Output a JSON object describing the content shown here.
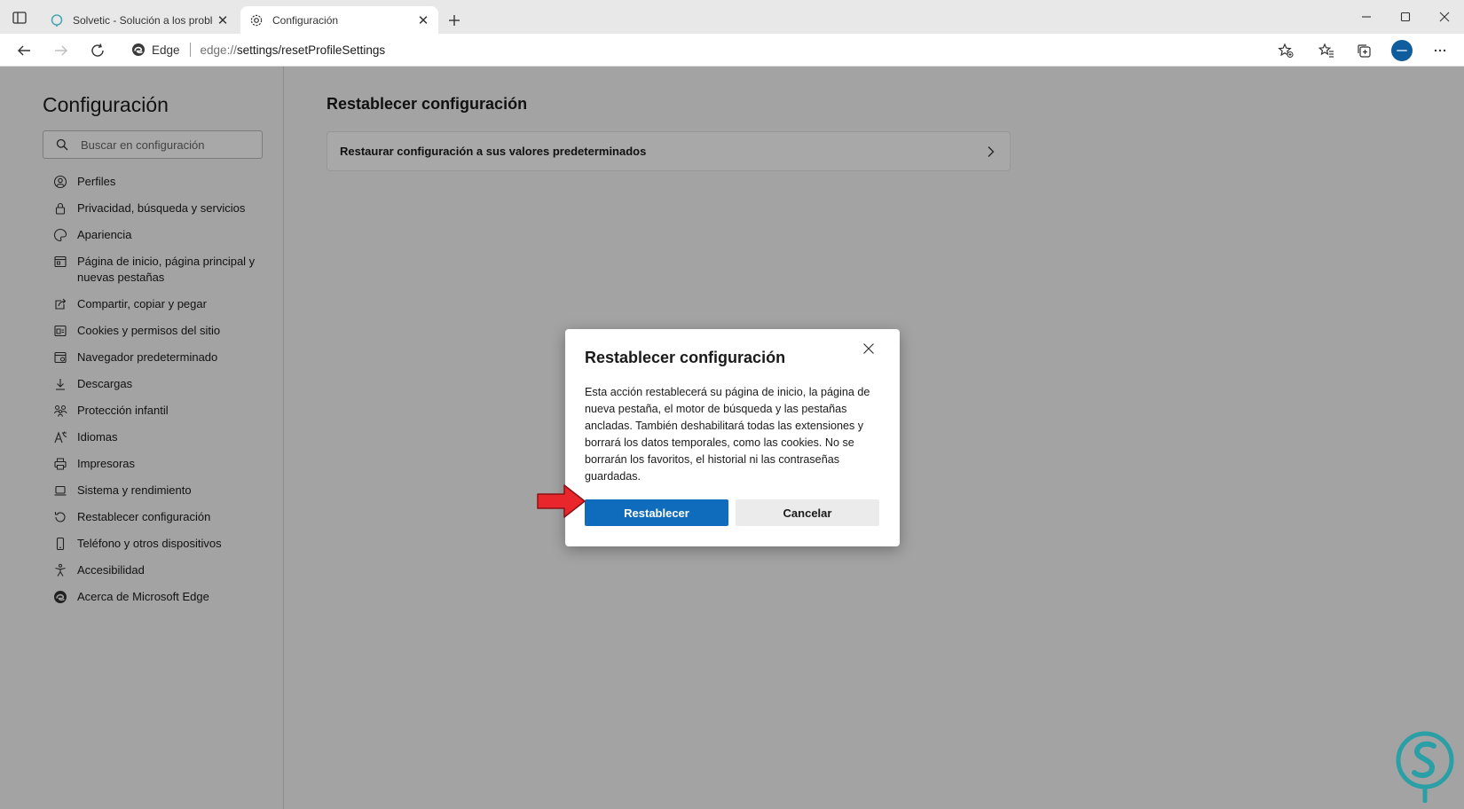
{
  "browser": {
    "tabs": [
      {
        "title": "Solvetic - Solución a los problem",
        "active": false
      },
      {
        "title": "Configuración",
        "active": true
      }
    ],
    "address": {
      "badge": "Edge",
      "scheme": "edge://",
      "path": "settings/resetProfileSettings"
    }
  },
  "settings": {
    "title": "Configuración",
    "search_placeholder": "Buscar en configuración",
    "nav": [
      {
        "label": "Perfiles",
        "icon": "profile-icon"
      },
      {
        "label": "Privacidad, búsqueda y servicios",
        "icon": "lock-icon"
      },
      {
        "label": "Apariencia",
        "icon": "palette-icon"
      },
      {
        "label": "Página de inicio, página principal y nuevas pestañas",
        "icon": "home-page-icon"
      },
      {
        "label": "Compartir, copiar y pegar",
        "icon": "share-icon"
      },
      {
        "label": "Cookies y permisos del sitio",
        "icon": "cookies-icon"
      },
      {
        "label": "Navegador predeterminado",
        "icon": "browser-icon"
      },
      {
        "label": "Descargas",
        "icon": "download-icon"
      },
      {
        "label": "Protección infantil",
        "icon": "family-icon"
      },
      {
        "label": "Idiomas",
        "icon": "language-icon"
      },
      {
        "label": "Impresoras",
        "icon": "printer-icon"
      },
      {
        "label": "Sistema y rendimiento",
        "icon": "laptop-icon"
      },
      {
        "label": "Restablecer configuración",
        "icon": "reset-icon"
      },
      {
        "label": "Teléfono y otros dispositivos",
        "icon": "phone-icon"
      },
      {
        "label": "Accesibilidad",
        "icon": "accessibility-icon"
      },
      {
        "label": "Acerca de Microsoft Edge",
        "icon": "edge-logo-icon"
      }
    ],
    "content_title": "Restablecer configuración",
    "reset_row": "Restaurar configuración a sus valores predeterminados"
  },
  "dialog": {
    "title": "Restablecer configuración",
    "body": "Esta acción restablecerá su página de inicio, la página de nueva pestaña, el motor de búsqueda y las pestañas ancladas. También deshabilitará todas las extensiones y borrará los datos temporales, como las cookies. No se borrarán los favoritos, el historial ni las contraseñas guardadas.",
    "confirm_label": "Restablecer",
    "cancel_label": "Cancelar"
  },
  "colors": {
    "primary_button": "#0f6cbd",
    "arrow": "#e8262c",
    "logo": "#2a9fa6"
  }
}
